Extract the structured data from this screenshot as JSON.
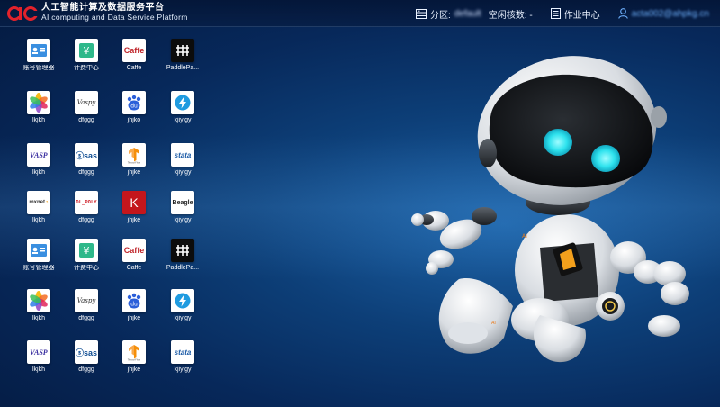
{
  "header": {
    "title_cn": "人工智能计算及数据服务平台",
    "title_en": "AI computing and Data Service Platform",
    "partition_label": "分区:",
    "partition_value": "default",
    "cores_label": "空闲核数: -",
    "jobs_label": "作业中心",
    "user_name": "acta002@ahpkg.cn"
  },
  "colors": {
    "accent": "#2f8fff",
    "background": "#0d3f78",
    "user_link": "#6fb2ff"
  },
  "apps": [
    [
      {
        "label": "账号管理器",
        "icon": "account-manager-icon"
      },
      {
        "label": "计费中心",
        "icon": "billing-center-icon"
      },
      {
        "label": "Caffe",
        "icon": "caffe-icon",
        "text": "Caffe"
      },
      {
        "label": "PaddlePa...",
        "icon": "paddle-icon"
      }
    ],
    [
      {
        "label": "lkjkh",
        "icon": "photos-icon"
      },
      {
        "label": "dfggg",
        "icon": "vaspy-icon",
        "text": "Vaspy"
      },
      {
        "label": "jhjko",
        "icon": "baidu-icon",
        "text": "du"
      },
      {
        "label": "kjiyigy",
        "icon": "flash-icon"
      }
    ],
    [
      {
        "label": "lkjkh",
        "icon": "vasp-icon",
        "text": "VASP"
      },
      {
        "label": "dfggg",
        "icon": "sas-icon",
        "text": "sas"
      },
      {
        "label": "jhjke",
        "icon": "tensorflow-icon",
        "text": "TensorFlow"
      },
      {
        "label": "kjiyigy",
        "icon": "stata-icon",
        "text": "stata"
      }
    ],
    [
      {
        "label": "lkjkh",
        "icon": "mxnet-icon",
        "text": "mxnet"
      },
      {
        "label": "dfggg",
        "icon": "dlpoly-icon",
        "text": "DL_POLY"
      },
      {
        "label": "jhjke",
        "icon": "k-icon",
        "text": "K"
      },
      {
        "label": "kjiyigy",
        "icon": "beagle-icon",
        "text": "Beagle"
      }
    ],
    [
      {
        "label": "账号管理器",
        "icon": "account-manager-icon"
      },
      {
        "label": "计费中心",
        "icon": "billing-center-icon"
      },
      {
        "label": "Caffe",
        "icon": "caffe-icon",
        "text": "Caffe"
      },
      {
        "label": "PaddlePa...",
        "icon": "paddle-icon"
      }
    ],
    [
      {
        "label": "lkjkh",
        "icon": "photos-icon"
      },
      {
        "label": "dfggg",
        "icon": "vaspy-icon",
        "text": "Vaspy"
      },
      {
        "label": "jhjke",
        "icon": "baidu-icon",
        "text": "du"
      },
      {
        "label": "kjiyigy",
        "icon": "flash-icon"
      }
    ],
    [
      {
        "label": "lkjkh",
        "icon": "vasp-icon",
        "text": "VASP"
      },
      {
        "label": "dfggg",
        "icon": "sas-icon",
        "text": "sas"
      },
      {
        "label": "jhjke",
        "icon": "tensorflow-icon",
        "text": "TensorFlow"
      },
      {
        "label": "kjiyigy",
        "icon": "stata-icon",
        "text": "stata"
      }
    ]
  ]
}
